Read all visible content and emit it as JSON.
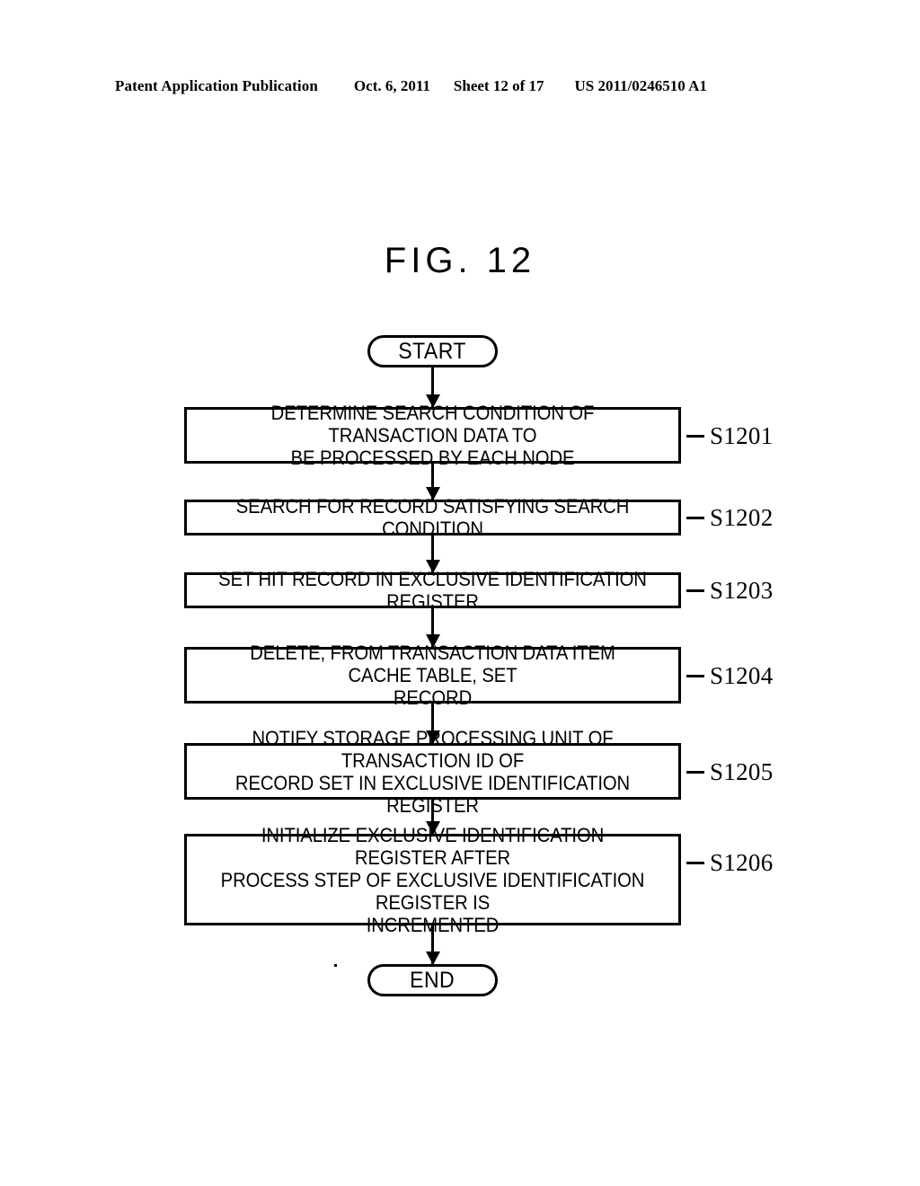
{
  "header": {
    "publication": "Patent Application Publication",
    "date": "Oct. 6, 2011",
    "sheet": "Sheet 12 of 17",
    "number": "US 2011/0246510 A1"
  },
  "figure": {
    "title": "FIG. 12"
  },
  "flowchart": {
    "start_label": "START",
    "end_label": "END",
    "steps": [
      {
        "text": "DETERMINE SEARCH CONDITION OF TRANSACTION DATA TO\nBE PROCESSED BY EACH NODE",
        "ref": "S1201"
      },
      {
        "text": "SEARCH FOR RECORD SATISFYING SEARCH CONDITION",
        "ref": "S1202"
      },
      {
        "text": "SET HIT RECORD IN EXCLUSIVE IDENTIFICATION REGISTER",
        "ref": "S1203"
      },
      {
        "text": "DELETE, FROM TRANSACTION DATA ITEM CACHE TABLE, SET\nRECORD",
        "ref": "S1204"
      },
      {
        "text": "NOTIFY STORAGE PROCESSING UNIT OF TRANSACTION ID OF\nRECORD SET IN EXCLUSIVE IDENTIFICATION REGISTER",
        "ref": "S1205"
      },
      {
        "text": "INITIALIZE EXCLUSIVE IDENTIFICATION REGISTER AFTER\nPROCESS STEP OF EXCLUSIVE IDENTIFICATION REGISTER IS\nINCREMENTED",
        "ref": "S1206"
      }
    ]
  }
}
